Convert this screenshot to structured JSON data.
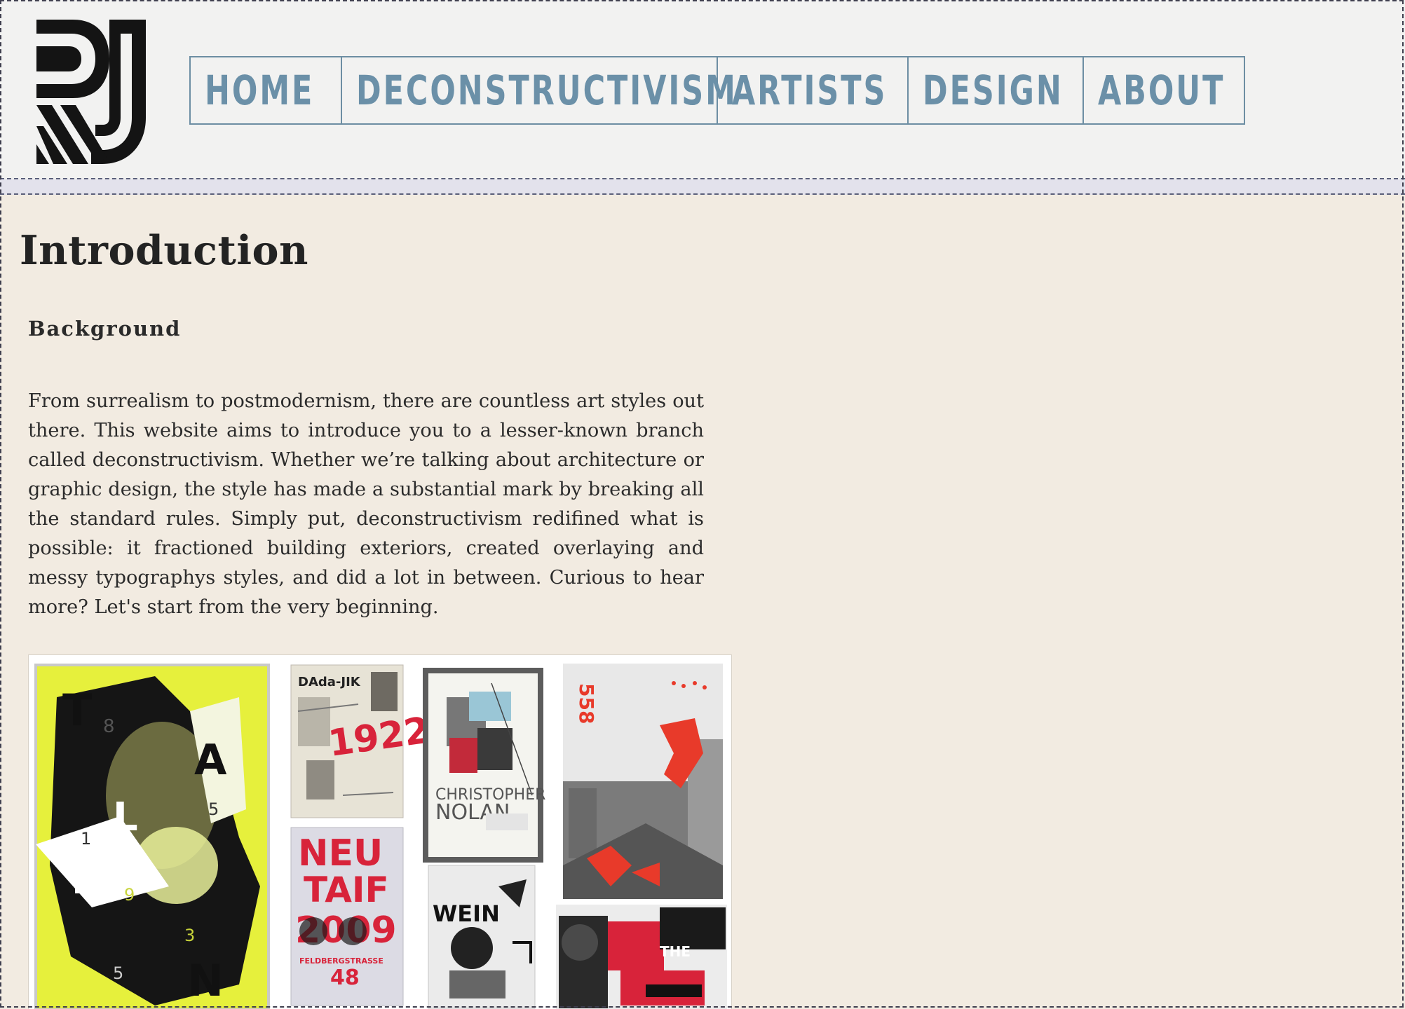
{
  "header": {
    "logo_alt": "RJ logo",
    "nav": [
      {
        "label": "HOME"
      },
      {
        "label": "DECONSTRUCTIVISM"
      },
      {
        "label": "ARTISTS"
      },
      {
        "label": "DESIGN"
      },
      {
        "label": "ABOUT"
      }
    ]
  },
  "main": {
    "title": "Introduction",
    "section_heading": "Background",
    "paragraph": "From surrealism to postmodernism, there are countless art styles out there. This website aims to introduce you to a lesser-known branch called deconstructivism. Whether we’re talking about architecture or graphic design, the style has made a substantial mark by breaking all the standard rules. Simply put, deconstructivism redifined what is possible: it fractioned building exteriors, created overlaying and messy typographys styles, and did a lot in between. Curious to hear more? Let's start from the very beginning.",
    "collage": {
      "poster_tallin": {
        "letters": [
          "T",
          "A",
          "L",
          "L",
          "I",
          "N"
        ],
        "numbers": [
          "8",
          "5",
          "1",
          "9",
          "3",
          "5"
        ]
      },
      "poster_dada": {
        "title": "DAda-JIK",
        "number": "1922"
      },
      "poster_nolan": {
        "line1": "CHRISTOPHER",
        "line2": "NOLAN"
      },
      "poster_street": {
        "number": "558"
      },
      "poster_red": {
        "line1": "NEU",
        "line2": "TAIF",
        "line3": "2009",
        "footer": "FELDBERGSTRASSE",
        "number": "48"
      },
      "poster_wein": {
        "title": "WEIN"
      },
      "poster_collage": {
        "text": "THE"
      }
    }
  },
  "colors": {
    "page_bg": "#f2ebe1",
    "header_bg": "#f2f2f1",
    "nav_text": "#6b90a8",
    "nav_border": "#6d8ea3",
    "text": "#2b2b2b",
    "poster_yellow": "#e6f03c",
    "poster_red": "#d8233a"
  }
}
